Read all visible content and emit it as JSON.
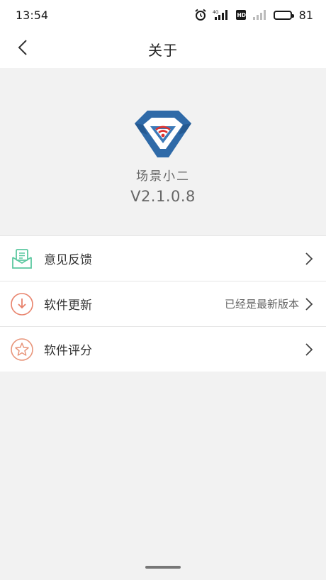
{
  "status_bar": {
    "time": "13:54",
    "battery": "81",
    "battery_level": 0.81,
    "icons": [
      "alarm-icon",
      "signal-4g-icon",
      "hd-icon",
      "signal-icon",
      "battery-icon"
    ]
  },
  "header": {
    "title": "关于",
    "back_icon": "chevron-left-icon"
  },
  "app": {
    "name": "场景小二",
    "version": "V2.1.0.8",
    "logo_icon": "app-logo-icon"
  },
  "menu": {
    "items": [
      {
        "label": "意见反馈",
        "value": "",
        "icon": "feedback-mail-icon"
      },
      {
        "label": "软件更新",
        "value": "已经是最新版本",
        "icon": "download-arrow-icon"
      },
      {
        "label": "软件评分",
        "value": "",
        "icon": "star-rating-icon"
      }
    ]
  },
  "colors": {
    "feedback_icon": "#5cc8a0",
    "update_icon": "#e8826b",
    "rating_icon": "#e8957a",
    "logo_blue": "#2f6aa8",
    "logo_red": "#e0322e"
  }
}
